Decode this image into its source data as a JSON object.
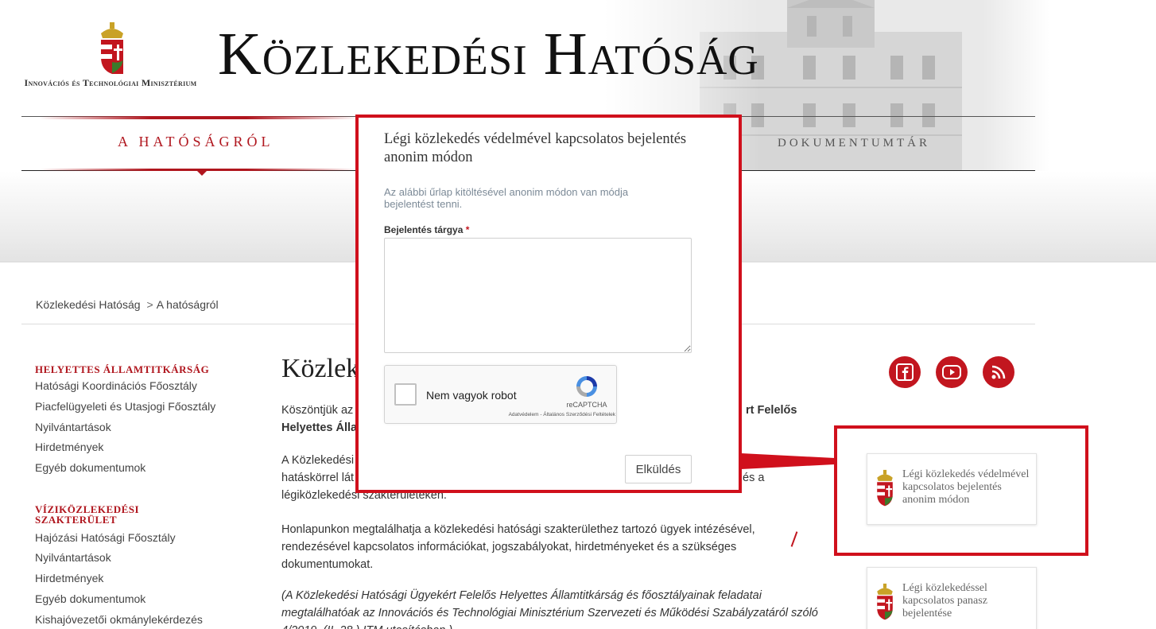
{
  "header": {
    "ministry": "Innovációs és Technológiai Minisztérium",
    "site_title": "Közlekedési Hatóság",
    "nav": {
      "hatosagrol": "A HATÓSÁGRÓL",
      "dokumentumtar": "DOKUMENTUMTÁR"
    }
  },
  "breadcrumb": {
    "home": "Közlekedési Hatóság",
    "separator": ">",
    "current": "A hatóságról"
  },
  "sidebar": {
    "sections": [
      {
        "heading": "HELYETTES ÁLLAMTITKÁRSÁG",
        "links": [
          "Hatósági Koordinációs Főosztály",
          "Piacfelügyeleti és Utasjogi Főosztály",
          "Nyilvántartások",
          "Hirdetmények",
          "Egyéb dokumentumok"
        ]
      },
      {
        "heading": "VÍZIKÖZLEKEDÉSI SZAKTERÜLET",
        "links": [
          "Hajózási Hatósági Főosztály",
          "Nyilvántartások",
          "Hirdetmények",
          "Egyéb dokumentumok",
          "Kishajóvezetői okmánylekérdezés"
        ]
      }
    ]
  },
  "main": {
    "title_visible": "Közlek",
    "p1_start": "Köszöntjük az",
    "p1_end_bold": "rt Felelős",
    "p1_line2_bold": "Helyettes Álla",
    "p2_start": "A Közlekedési",
    "p2_line2_start": "hatáskörrel lát",
    "p2_line2_end": "és a",
    "p2_line3": "légiközlekedési szakterületeken.",
    "p3": "Honlapunkon megtalálhatja a közlekedési hatósági szakterülethez tartozó ügyek intézésével, rendezésével kapcsolatos információkat, jogszabályokat, hirdetményeket és a szükséges dokumentumokat.",
    "p4": "(A Közlekedési Hatósági Ügyekért Felelős Helyettes Államtitkárság és főosztályainak feladatai megtalálhatóak az Innovációs és Technológiai Minisztérium Szervezeti és Működési Szabályzatáról szóló 4/2019. (II. 28.) ITM utasításban.)"
  },
  "social": {
    "facebook": "facebook-icon",
    "youtube": "youtube-icon",
    "rss": "rss-icon",
    "color": "#c2161f"
  },
  "cards": [
    {
      "text": "Légi közlekedés védelmével kapcsolatos bejelentés anonim módon"
    },
    {
      "text": "Légi közlekedéssel kapcsolatos panasz bejelentése"
    }
  ],
  "modal": {
    "title": "Légi közlekedés védelmével kapcsolatos bejelentés anonim módon",
    "description": "Az alábbi űrlap kitöltésével anonim módon van módja bejelentést tenni.",
    "field_label": "Bejelentés tárgya",
    "required_mark": "*",
    "field_value": "",
    "captcha": {
      "label": "Nem vagyok robot",
      "brand": "reCAPTCHA",
      "links": "Adatvédelem - Általános Szerződési Feltételek"
    },
    "submit": "Elküldés"
  },
  "colors": {
    "accent": "#b0161e",
    "highlight": "#d0101c"
  }
}
